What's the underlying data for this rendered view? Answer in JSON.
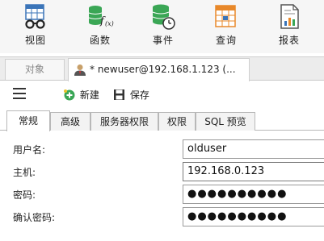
{
  "toolbar": {
    "items": [
      {
        "label": "视图",
        "icon": "view-table-glasses-icon"
      },
      {
        "label": "函数",
        "icon": "function-database-icon"
      },
      {
        "label": "事件",
        "icon": "event-database-clock-icon"
      },
      {
        "label": "查询",
        "icon": "query-table-icon"
      },
      {
        "label": "报表",
        "icon": "report-chart-icon"
      }
    ]
  },
  "tabs": {
    "objects_label": "对象",
    "user_tab_label": "* newuser@192.168.1.123 (..."
  },
  "actions": {
    "new_label": "新建",
    "save_label": "保存"
  },
  "subtabs": [
    {
      "label": "常规",
      "active": true
    },
    {
      "label": "高级",
      "active": false
    },
    {
      "label": "服务器权限",
      "active": false
    },
    {
      "label": "权限",
      "active": false
    },
    {
      "label": "SQL 预览",
      "active": false
    }
  ],
  "form": {
    "username": {
      "label": "用户名:",
      "value": "olduser"
    },
    "host": {
      "label": "主机:",
      "value": "192.168.0.123"
    },
    "password": {
      "label": "密码:",
      "value": "●●●●●●●●●●"
    },
    "confirm_password": {
      "label": "确认密码:",
      "value": "●●●●●●●●●●"
    }
  },
  "colors": {
    "green_accent": "#3aa655",
    "blue_accent": "#3a74b8",
    "orange_accent": "#e8882a",
    "toolbar_bg": "#f6f6f6"
  }
}
